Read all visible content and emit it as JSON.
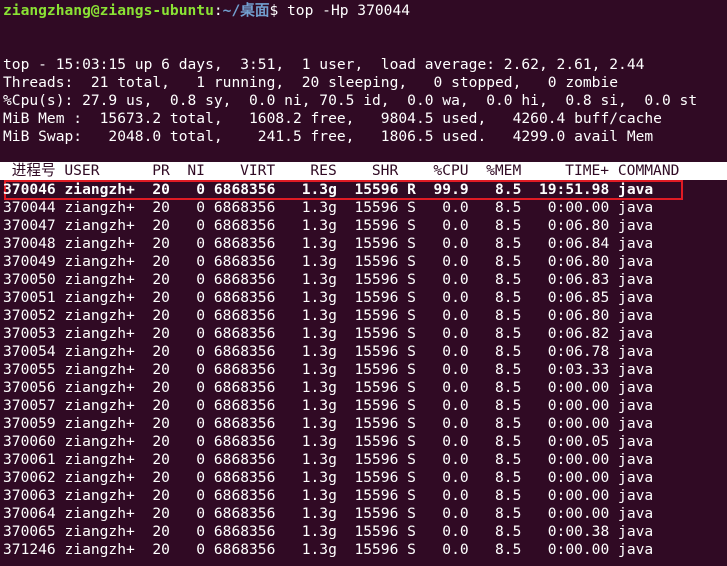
{
  "prompt": {
    "user_host": "ziangzhang@ziangs-ubuntu",
    "separator": ":",
    "path": "~/桌面",
    "symbol": "$ ",
    "command": "top -Hp 370044"
  },
  "summary": [
    "top - 15:03:15 up 6 days,  3:51,  1 user,  load average: 2.62, 2.61, 2.44",
    "Threads:  21 total,   1 running,  20 sleeping,   0 stopped,   0 zombie",
    "%Cpu(s): 27.9 us,  0.8 sy,  0.0 ni, 70.5 id,  0.0 wa,  0.0 hi,  0.8 si,  0.0 st",
    "MiB Mem :  15673.2 total,   1608.2 free,   9804.5 used,   4260.4 buff/cache",
    "MiB Swap:   2048.0 total,    241.5 free,   1806.5 used.   4299.0 avail Mem"
  ],
  "table": {
    "header": " 进程号 USER      PR  NI    VIRT    RES    SHR    %CPU  %MEM     TIME+ COMMAND",
    "highlighted_row": "370046 ziangzh+  20   0 6868356   1.3g  15596 R  99.9   8.5  19:51.98 java",
    "rows": [
      "370044 ziangzh+  20   0 6868356   1.3g  15596 S   0.0   8.5   0:00.00 java",
      "370047 ziangzh+  20   0 6868356   1.3g  15596 S   0.0   8.5   0:06.80 java",
      "370048 ziangzh+  20   0 6868356   1.3g  15596 S   0.0   8.5   0:06.84 java",
      "370049 ziangzh+  20   0 6868356   1.3g  15596 S   0.0   8.5   0:06.80 java",
      "370050 ziangzh+  20   0 6868356   1.3g  15596 S   0.0   8.5   0:06.83 java",
      "370051 ziangzh+  20   0 6868356   1.3g  15596 S   0.0   8.5   0:06.85 java",
      "370052 ziangzh+  20   0 6868356   1.3g  15596 S   0.0   8.5   0:06.80 java",
      "370053 ziangzh+  20   0 6868356   1.3g  15596 S   0.0   8.5   0:06.82 java",
      "370054 ziangzh+  20   0 6868356   1.3g  15596 S   0.0   8.5   0:06.78 java",
      "370055 ziangzh+  20   0 6868356   1.3g  15596 S   0.0   8.5   0:03.33 java",
      "370056 ziangzh+  20   0 6868356   1.3g  15596 S   0.0   8.5   0:00.00 java",
      "370057 ziangzh+  20   0 6868356   1.3g  15596 S   0.0   8.5   0:00.00 java",
      "370059 ziangzh+  20   0 6868356   1.3g  15596 S   0.0   8.5   0:00.00 java",
      "370060 ziangzh+  20   0 6868356   1.3g  15596 S   0.0   8.5   0:00.05 java",
      "370061 ziangzh+  20   0 6868356   1.3g  15596 S   0.0   8.5   0:00.00 java",
      "370062 ziangzh+  20   0 6868356   1.3g  15596 S   0.0   8.5   0:00.00 java",
      "370063 ziangzh+  20   0 6868356   1.3g  15596 S   0.0   8.5   0:00.00 java",
      "370064 ziangzh+  20   0 6868356   1.3g  15596 S   0.0   8.5   0:00.00 java",
      "370065 ziangzh+  20   0 6868356   1.3g  15596 S   0.0   8.5   0:00.38 java",
      "371246 ziangzh+  20   0 6868356   1.3g  15596 S   0.0   8.5   0:00.00 java"
    ]
  },
  "colors": {
    "background": "#300a24",
    "prompt_user": "#8ae234",
    "prompt_path": "#729fcf",
    "highlight_border": "#e01b24",
    "header_background": "#ffffff"
  }
}
